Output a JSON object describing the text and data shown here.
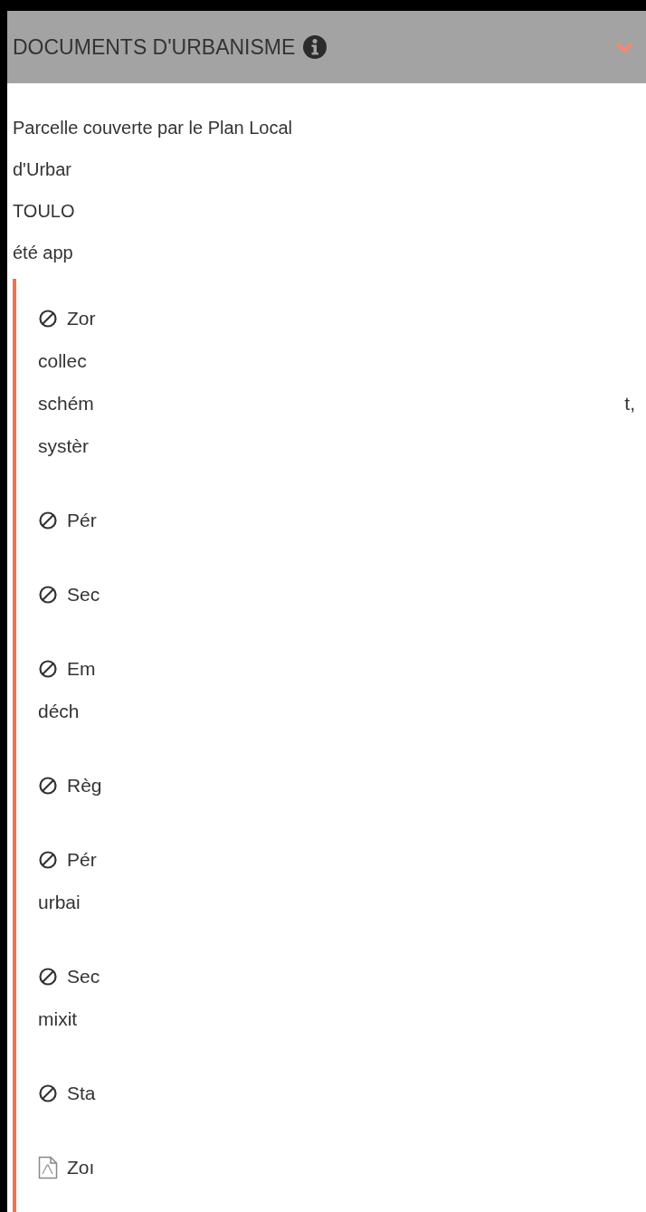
{
  "header": {
    "title": "DOCUMENTS D'URBANISME",
    "expanded": true
  },
  "intro_lines": [
    "Parcelle couverte par le Plan Local",
    "d'Urbar",
    "TOULO",
    "été app"
  ],
  "items": [
    {
      "kind": "forbidden",
      "lines": [
        "Zor",
        "collec",
        "schém",
        "systèr"
      ],
      "edge_text": "t,"
    },
    {
      "kind": "forbidden",
      "lines": [
        "Pér"
      ]
    },
    {
      "kind": "forbidden",
      "lines": [
        "Sec"
      ]
    },
    {
      "kind": "forbidden",
      "lines": [
        "Em",
        "déch"
      ]
    },
    {
      "kind": "forbidden",
      "lines": [
        "Règ"
      ]
    },
    {
      "kind": "forbidden",
      "lines": [
        "Pér",
        "urbai"
      ]
    },
    {
      "kind": "forbidden",
      "lines": [
        "Sec",
        "mixit"
      ]
    },
    {
      "kind": "forbidden",
      "lines": [
        "Sta"
      ]
    },
    {
      "kind": "pdf",
      "lines": [
        "Zoı"
      ]
    }
  ]
}
